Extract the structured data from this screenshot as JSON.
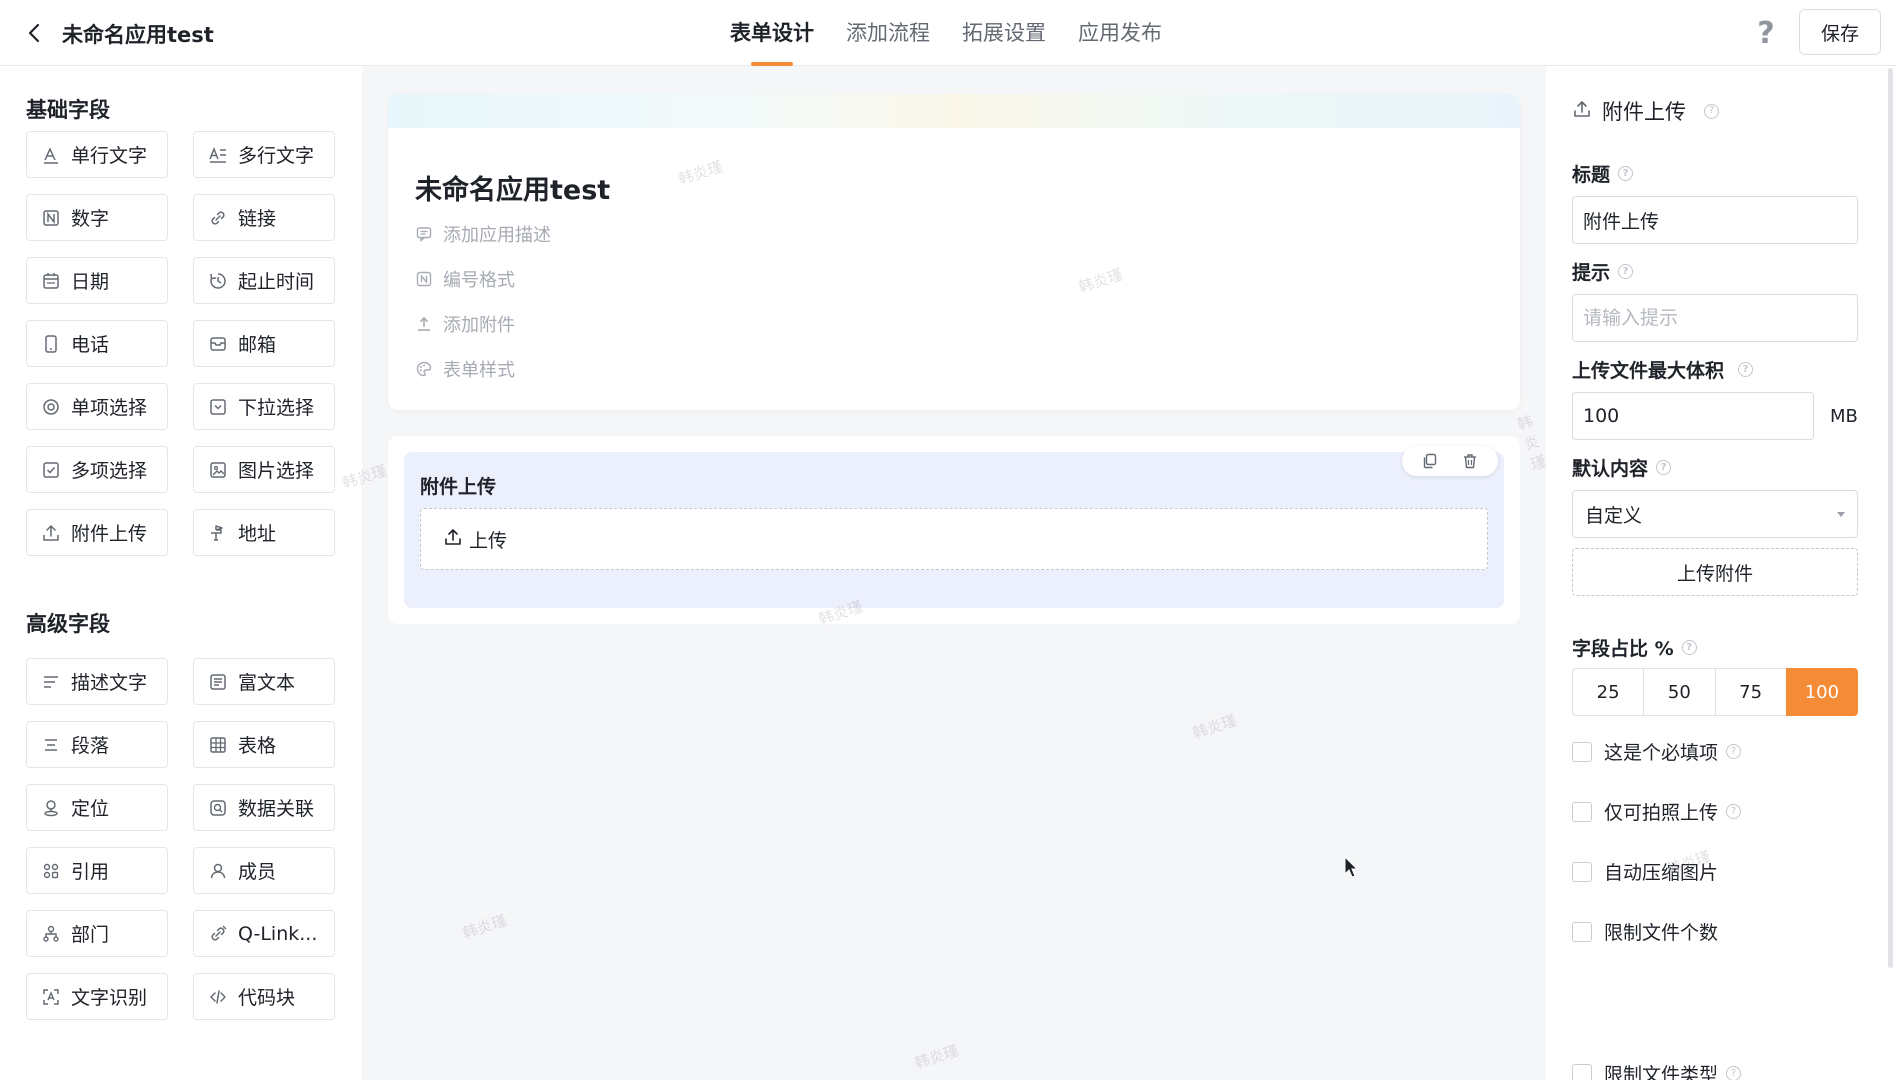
{
  "header": {
    "app_title": "未命名应用test",
    "tabs": [
      {
        "label": "表单设计",
        "active": true
      },
      {
        "label": "添加流程",
        "active": false
      },
      {
        "label": "拓展设置",
        "active": false
      },
      {
        "label": "应用发布",
        "active": false
      }
    ],
    "help_glyph": "?",
    "save_label": "保存"
  },
  "palette": {
    "basic_title": "基础字段",
    "basic_fields": [
      {
        "label": "单行文字",
        "icon": "single-line-text-icon"
      },
      {
        "label": "多行文字",
        "icon": "multi-line-text-icon"
      },
      {
        "label": "数字",
        "icon": "number-icon"
      },
      {
        "label": "链接",
        "icon": "link-icon"
      },
      {
        "label": "日期",
        "icon": "calendar-icon"
      },
      {
        "label": "起止时间",
        "icon": "time-range-icon"
      },
      {
        "label": "电话",
        "icon": "phone-icon"
      },
      {
        "label": "邮箱",
        "icon": "mail-icon"
      },
      {
        "label": "单项选择",
        "icon": "radio-icon"
      },
      {
        "label": "下拉选择",
        "icon": "dropdown-icon"
      },
      {
        "label": "多项选择",
        "icon": "checkbox-icon"
      },
      {
        "label": "图片选择",
        "icon": "image-icon"
      },
      {
        "label": "附件上传",
        "icon": "upload-icon"
      },
      {
        "label": "地址",
        "icon": "address-icon"
      }
    ],
    "advanced_title": "高级字段",
    "advanced_fields": [
      {
        "label": "描述文字",
        "icon": "description-icon"
      },
      {
        "label": "富文本",
        "icon": "rich-text-icon"
      },
      {
        "label": "段落",
        "icon": "paragraph-icon"
      },
      {
        "label": "表格",
        "icon": "table-icon"
      },
      {
        "label": "定位",
        "icon": "location-icon"
      },
      {
        "label": "数据关联",
        "icon": "data-link-icon"
      },
      {
        "label": "引用",
        "icon": "reference-icon"
      },
      {
        "label": "成员",
        "icon": "member-icon"
      },
      {
        "label": "部门",
        "icon": "department-icon"
      },
      {
        "label": "Q-Link...",
        "icon": "q-link-icon"
      },
      {
        "label": "文字识别",
        "icon": "ocr-icon"
      },
      {
        "label": "代码块",
        "icon": "code-icon"
      }
    ]
  },
  "form": {
    "title": "未命名应用test",
    "meta": [
      {
        "label": "添加应用描述",
        "icon": "comment-icon"
      },
      {
        "label": "编号格式",
        "icon": "number-format-icon"
      },
      {
        "label": "添加附件",
        "icon": "attachment-icon"
      },
      {
        "label": "表单样式",
        "icon": "palette-icon"
      }
    ],
    "field": {
      "label": "附件上传",
      "upload_label": "上传"
    },
    "watermark": "韩炎瑾"
  },
  "props": {
    "header": "附件上传",
    "title_label": "标题",
    "title_value": "附件上传",
    "hint_label": "提示",
    "hint_placeholder": "请输入提示",
    "max_size_label": "上传文件最大体积",
    "max_size_value": "100",
    "max_size_unit": "MB",
    "default_label": "默认内容",
    "default_value": "自定义",
    "upload_attachment_label": "上传附件",
    "ratio_label": "字段占比 %",
    "ratio_options": [
      "25",
      "50",
      "75",
      "100"
    ],
    "ratio_selected": "100",
    "checkboxes": [
      {
        "label": "这是个必填项",
        "help": true,
        "checked": false
      },
      {
        "label": "仅可拍照上传",
        "help": true,
        "checked": false
      },
      {
        "label": "自动压缩图片",
        "help": false,
        "checked": false
      },
      {
        "label": "限制文件个数",
        "help": false,
        "checked": false
      },
      {
        "label": "限制文件类型",
        "help": true,
        "checked": false
      }
    ]
  },
  "colors": {
    "accent": "#f38b37",
    "selected_field_bg": "#eceffc",
    "canvas_bg": "#f5f6f7"
  }
}
